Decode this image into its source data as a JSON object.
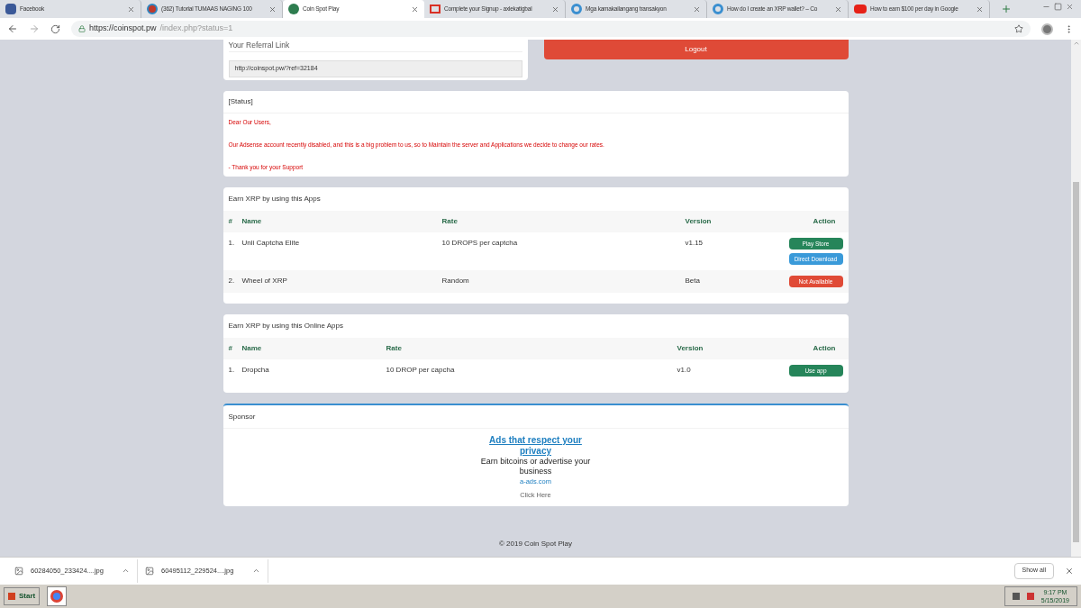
{
  "browser": {
    "tabs": [
      {
        "title": "Facebook",
        "selected": false
      },
      {
        "title": "(362) Tutorial TUMAAS NAGING 100",
        "selected": false
      },
      {
        "title": "Coin Spot Play",
        "selected": true
      },
      {
        "title": "Complete your Signup - axlekatigbal",
        "selected": false
      },
      {
        "title": "Mga kamakailangang transakyon",
        "selected": false
      },
      {
        "title": "How do I create an XRP wallet? – Co",
        "selected": false
      },
      {
        "title": "How to earn $100 per day in Google",
        "selected": false
      }
    ],
    "url_host": "https://coinspot.pw",
    "url_path": "/index.php?status=1"
  },
  "referral": {
    "title": "Your Referral Link",
    "link": "http://coinspot.pw/?ref=32184"
  },
  "logout": "Logout",
  "status": {
    "title": "[Status]",
    "lines": [
      "Dear Our Users,",
      "Our Adsense account recently disabled, and this is a big problem to us, so to Maintain the server and Applications we decide to change our rates.",
      "- Thank you for your Support"
    ]
  },
  "apps": {
    "title": "Earn XRP by using this Apps",
    "columns": [
      "#",
      "Name",
      "Rate",
      "Version",
      "Action"
    ],
    "rows": [
      {
        "num": "1.",
        "name": "Unli Captcha Elite",
        "rate": "10 DROPS per captcha",
        "version": "v1.15",
        "actions": [
          {
            "label": "Play Store",
            "kind": "green"
          },
          {
            "label": "Direct Download",
            "kind": "blue"
          }
        ]
      },
      {
        "num": "2.",
        "name": "Wheel of XRP",
        "rate": "Random",
        "version": "Beta",
        "actions": [
          {
            "label": "Not Available",
            "kind": "red"
          }
        ]
      }
    ]
  },
  "online_apps": {
    "title": "Earn XRP by using this Online Apps",
    "columns": [
      "#",
      "Name",
      "Rate",
      "Version",
      "Action"
    ],
    "rows": [
      {
        "num": "1.",
        "name": "Dropcha",
        "rate": "10 DROP per capcha",
        "version": "v1.0",
        "actions": [
          {
            "label": "Use app",
            "kind": "green"
          }
        ]
      }
    ]
  },
  "sponsor": {
    "title": "Sponsor",
    "ad_title": "Ads that respect your privacy",
    "ad_text": "Earn bitcoins or advertise your business",
    "ad_domain": "a-ads.com",
    "cta": "Click Here"
  },
  "footer": "© 2019 Coin Spot Play",
  "downloads": [
    {
      "name": "60284050_233424....jpg"
    },
    {
      "name": "60495112_229524....jpg"
    }
  ],
  "show_all": "Show all",
  "taskbar": {
    "start": "Start",
    "time": "9:17 PM",
    "date": "5/15/2019"
  }
}
